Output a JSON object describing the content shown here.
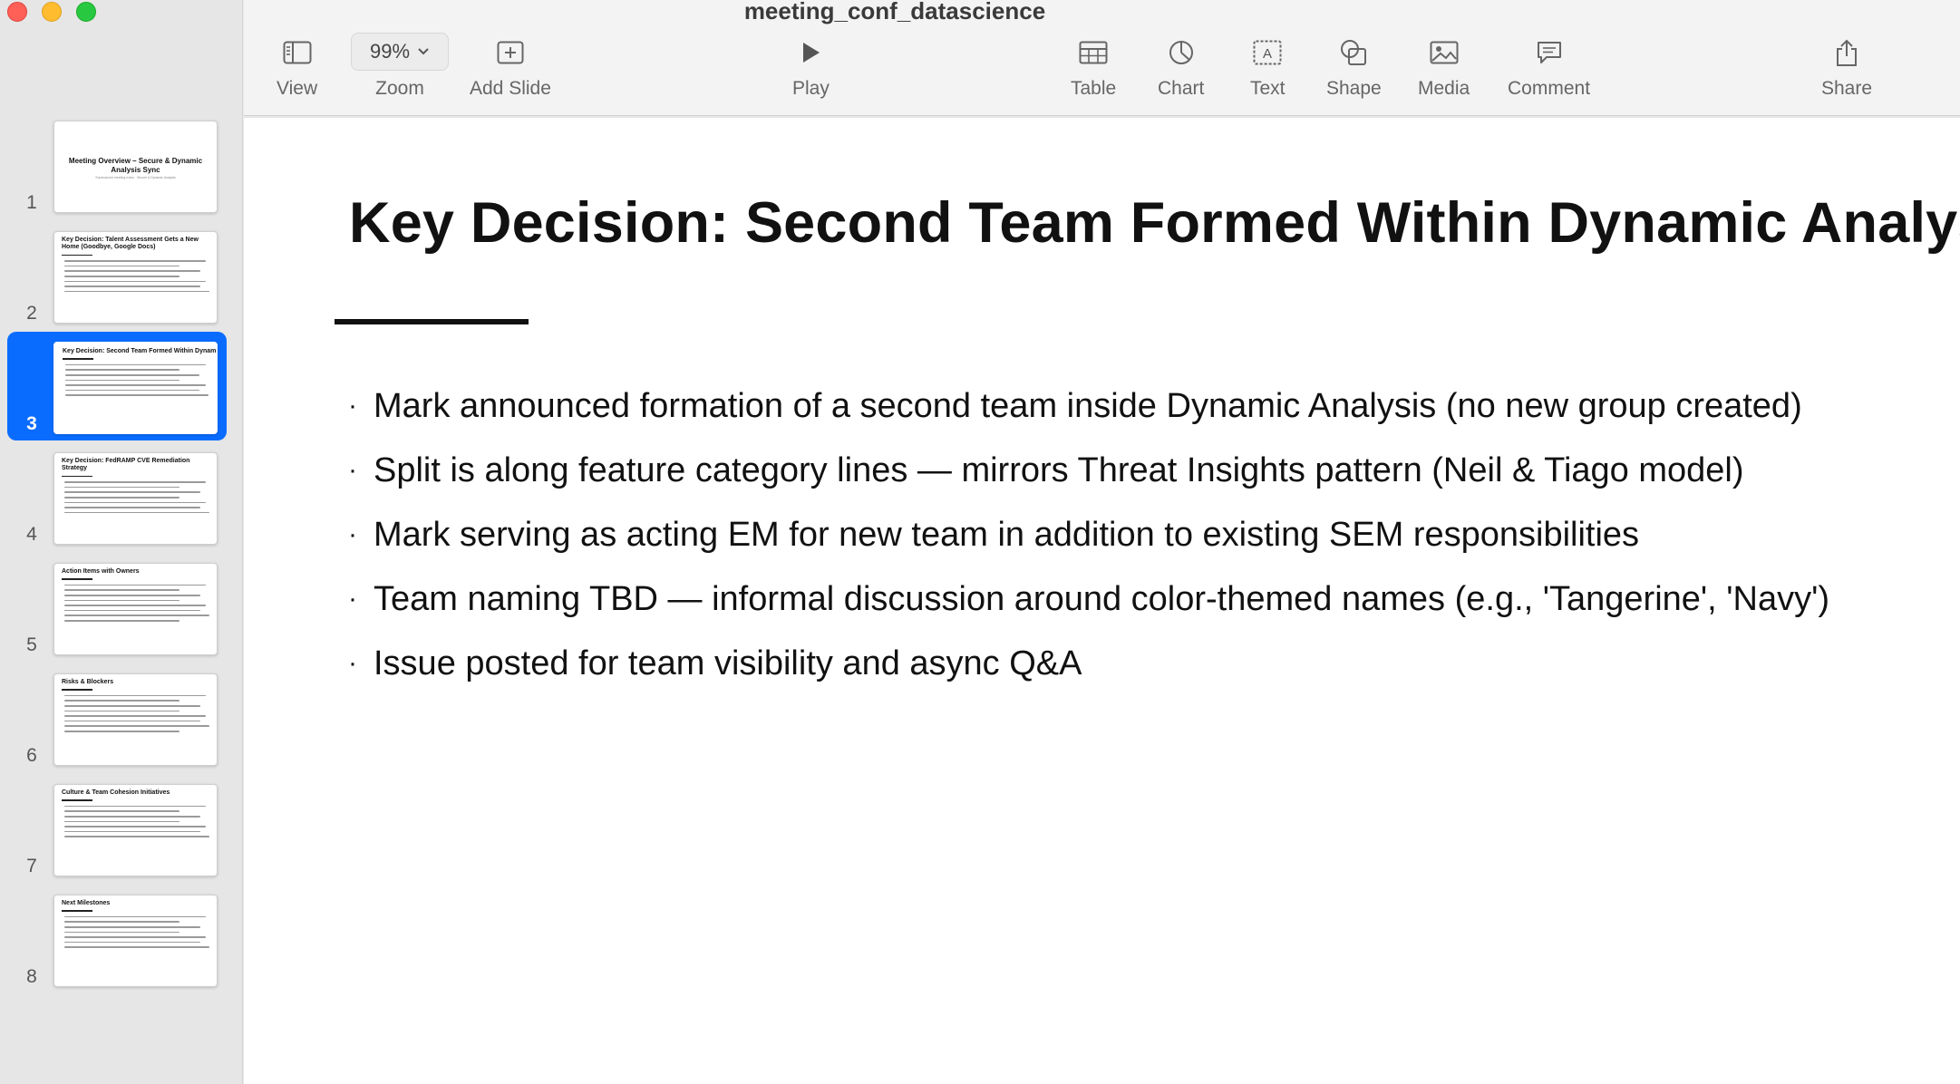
{
  "window": {
    "title": "meeting_conf_datascience"
  },
  "toolbar": {
    "view": "View",
    "zoom_label": "Zoom",
    "zoom_value": "99%",
    "add_slide": "Add Slide",
    "play": "Play",
    "table": "Table",
    "chart": "Chart",
    "text": "Text",
    "shape": "Shape",
    "media": "Media",
    "comment": "Comment",
    "share": "Share"
  },
  "sidebar": {
    "slides": [
      {
        "number": "1",
        "title": "Meeting Overview – Secure & Dynamic Analysis Sync",
        "subtitle": "Summarized meeting notes · Secure & Dynamic Analysis"
      },
      {
        "number": "2",
        "title": "Key Decision: Talent Assessment Gets a New Home (Goodbye, Google Docs)"
      },
      {
        "number": "3",
        "title": "Key Decision: Second Team Formed Within Dynamic Analysis"
      },
      {
        "number": "4",
        "title": "Key Decision: FedRAMP CVE Remediation Strategy"
      },
      {
        "number": "5",
        "title": "Action Items with Owners"
      },
      {
        "number": "6",
        "title": "Risks & Blockers"
      },
      {
        "number": "7",
        "title": "Culture & Team Cohesion Initiatives"
      },
      {
        "number": "8",
        "title": "Next Milestones"
      }
    ],
    "selected": "3"
  },
  "slide": {
    "title": "Key Decision: Second Team Formed Within Dynamic Analysis",
    "bullets": [
      "Mark announced formation of a second team inside Dynamic Analysis (no new group created)",
      "Split is along feature category lines — mirrors Threat Insights pattern (Neil & Tiago model)",
      "Mark serving as acting EM for new team in addition to existing SEM responsibilities",
      "Team naming TBD — informal discussion around color-themed names (e.g., 'Tangerine', 'Navy')",
      "Issue posted for team visibility and async Q&A"
    ],
    "bullet_glyph": "·"
  },
  "icons": {
    "view": "sidebar-icon",
    "zoom": "chevron-down-icon",
    "add_slide": "plus-square-icon",
    "play": "play-icon",
    "table": "table-icon",
    "chart": "pie-chart-icon",
    "text": "text-box-icon",
    "shape": "shape-icon",
    "media": "image-icon",
    "comment": "comment-icon",
    "share": "share-icon"
  },
  "colors": {
    "selection": "#0a6cff",
    "close": "#fe5f57",
    "minimize": "#febc2e",
    "maximize": "#28c840"
  }
}
